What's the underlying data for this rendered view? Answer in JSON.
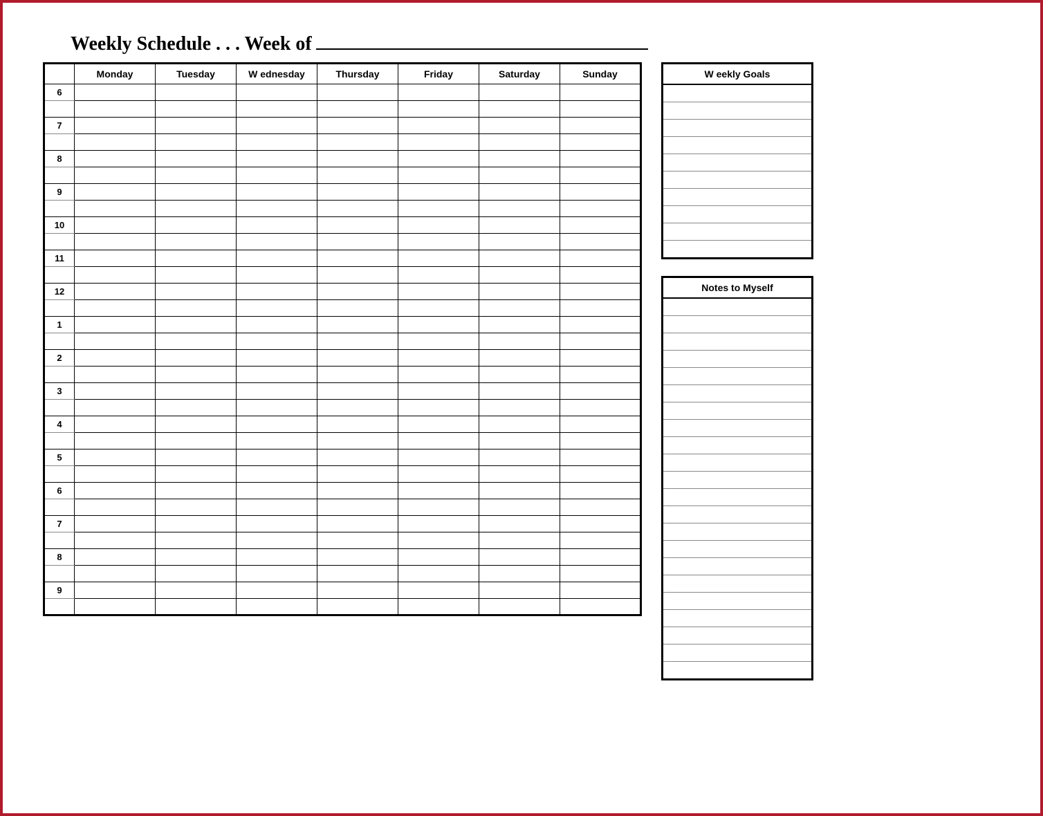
{
  "title": "Weekly Schedule . . . Week of",
  "days": [
    "Monday",
    "Tuesday",
    "W ednesday",
    "Thursday",
    "Friday",
    "Saturday",
    "Sunday"
  ],
  "hours": [
    "6",
    "7",
    "8",
    "9",
    "10",
    "11",
    "12",
    "1",
    "2",
    "3",
    "4",
    "5",
    "6",
    "7",
    "8",
    "9"
  ],
  "goals_title": "W eekly Goals",
  "notes_title": "Notes to Myself",
  "goals_lines": 10,
  "notes_lines": 22
}
